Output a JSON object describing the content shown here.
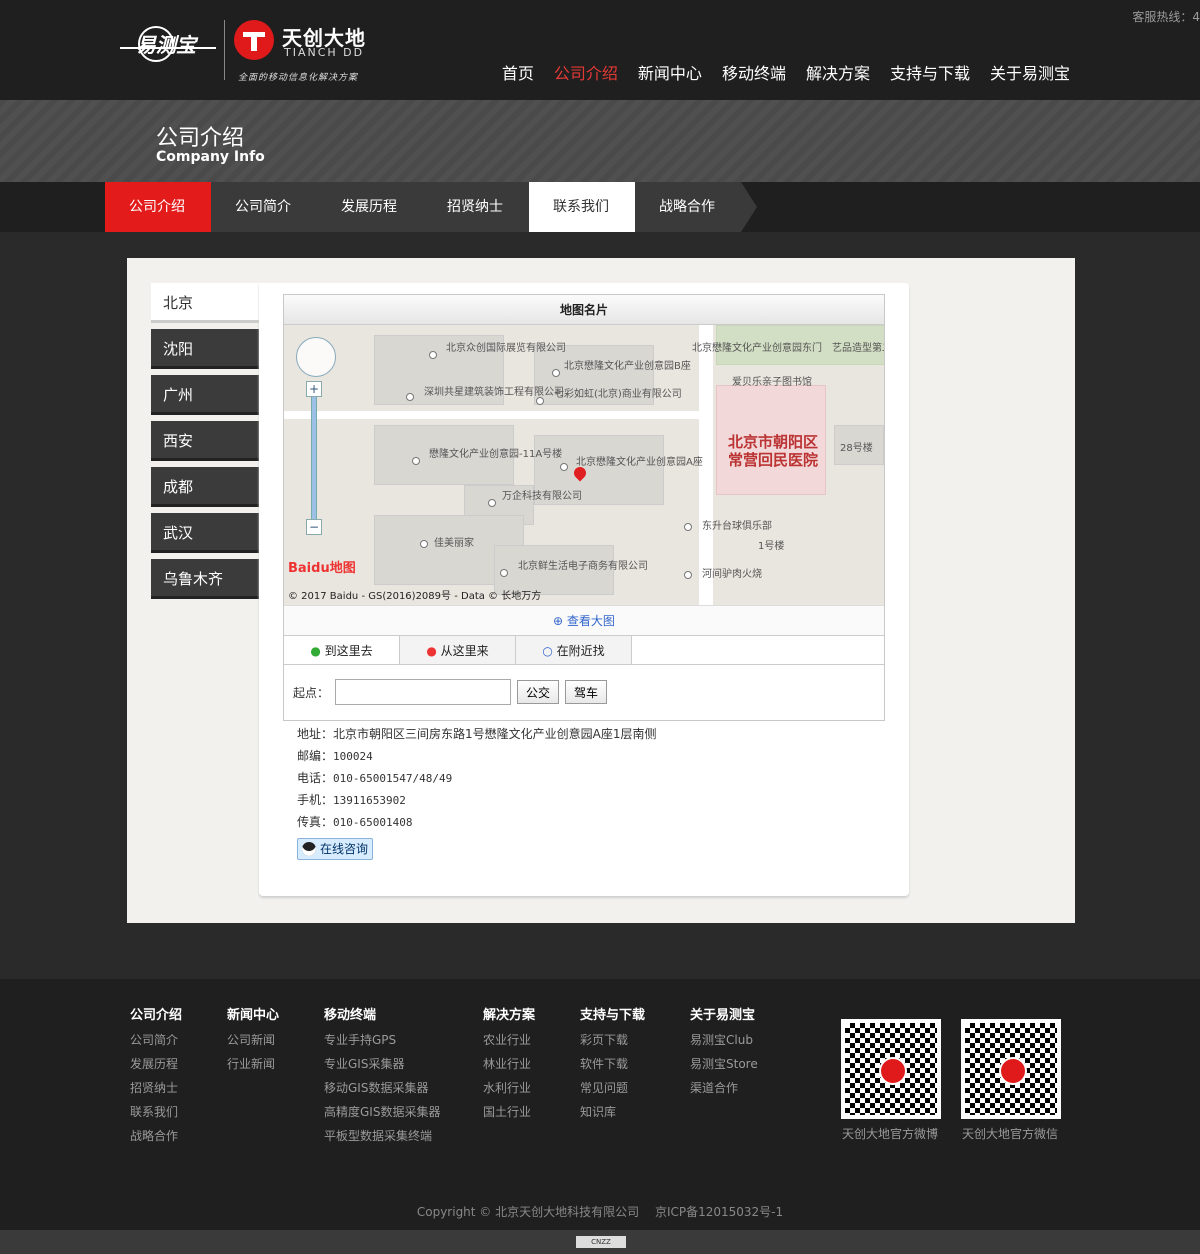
{
  "header": {
    "hotline": "客服热线：4",
    "logo1_text": "易测宝",
    "logo2_cn": "天创大地",
    "logo2_en": "TIANCH DD",
    "logo2_slogan": "全面的移动信息化解决方案",
    "nav": [
      "首页",
      "公司介绍",
      "新闻中心",
      "移动终端",
      "解决方案",
      "支持与下载",
      "关于易测宝"
    ],
    "nav_active": "公司介绍"
  },
  "banner": {
    "title": "公司介绍",
    "subtitle": "Company Info"
  },
  "subnav": [
    "公司介绍",
    "公司简介",
    "发展历程",
    "招贤纳士",
    "联系我们",
    "战略合作"
  ],
  "cities": [
    "北京",
    "沈阳",
    "广州",
    "西安",
    "成都",
    "武汉",
    "乌鲁木齐"
  ],
  "map": {
    "title": "地图名片",
    "pois": [
      "北京众创国际展览有限公司",
      "北京懋隆文化产业创意园B座",
      "北京懋隆文化产业创意园东门",
      "艺品造型第二分店",
      "深圳共星建筑装饰工程有限公司",
      "七彩如虹(北京)商业有限公司",
      "爱贝乐亲子图书馆",
      "懋隆文化产业创意园-11A号楼",
      "北京懋隆文化产业创意园A座",
      "万企科技有限公司",
      "东升台球俱乐部",
      "佳美丽家",
      "北京鲜生活电子商务有限公司",
      "河间驴肉火烧",
      "28号楼",
      "1号楼"
    ],
    "hospital": "北京市朝阳区常营回民医院",
    "baidu": "Baidu地图",
    "copyright": "© 2017 Baidu - GS(2016)2089号 - Data © 长地万方",
    "view_large": "查看大图",
    "tabs": [
      "到这里去",
      "从这里来",
      "在附近找"
    ],
    "start_label": "起点：",
    "start_value": "",
    "btn_bus": "公交",
    "btn_drive": "驾车"
  },
  "contact": {
    "address_label": "地址：",
    "address": "北京市朝阳区三间房东路1号懋隆文化产业创意园A座1层南侧",
    "zip_label": "邮编：",
    "zip": "100024",
    "phone_label": "电话：",
    "phone": "010-65001547/48/49",
    "mobile_label": "手机：",
    "mobile": "13911653902",
    "fax_label": "传真：",
    "fax": "010-65001408",
    "qq": "在线咨询"
  },
  "footer": {
    "cols": [
      {
        "head": "公司介绍",
        "links": [
          "公司简介",
          "发展历程",
          "招贤纳士",
          "联系我们",
          "战略合作"
        ]
      },
      {
        "head": "新闻中心",
        "links": [
          "公司新闻",
          "行业新闻"
        ]
      },
      {
        "head": "移动终端",
        "links": [
          "专业手持GPS",
          "专业GIS采集器",
          "移动GIS数据采集器",
          "高精度GIS数据采集器",
          "平板型数据采集终端"
        ]
      },
      {
        "head": "解决方案",
        "links": [
          "农业行业",
          "林业行业",
          "水利行业",
          "国土行业"
        ]
      },
      {
        "head": "支持与下载",
        "links": [
          "彩页下载",
          "软件下载",
          "常见问题",
          "知识库"
        ]
      },
      {
        "head": "关于易测宝",
        "links": [
          "易测宝Club",
          "易测宝Store",
          "渠道合作"
        ]
      }
    ],
    "qr1_caption": "天创大地官方微博",
    "qr2_caption": "天创大地官方微信",
    "copyright": "Copyright © 北京天创大地科技有限公司　 京ICP备12015032号-1",
    "cnzz": "CNZZ"
  }
}
